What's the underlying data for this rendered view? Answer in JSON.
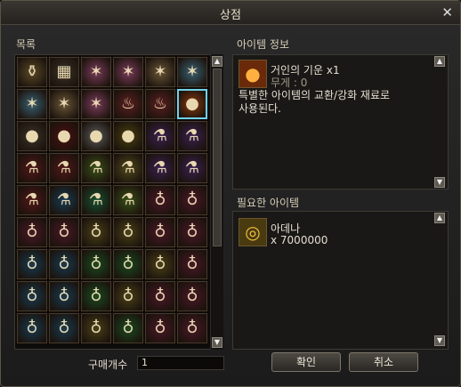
{
  "window": {
    "title": "상점",
    "close_glyph": "✕"
  },
  "list": {
    "label": "목록",
    "items": [
      {
        "icon": "jar-icon",
        "glyph": "⚱",
        "bg": "#5a4a28"
      },
      {
        "icon": "ladder-icon",
        "glyph": "▦",
        "bg": "#3c3428"
      },
      {
        "icon": "pink-scroll-icon",
        "glyph": "✶",
        "bg": "#7a3c5a"
      },
      {
        "icon": "pink-scroll-icon",
        "glyph": "✶",
        "bg": "#7a3c5a"
      },
      {
        "icon": "tan-scroll-icon",
        "glyph": "✶",
        "bg": "#6a5638"
      },
      {
        "icon": "blue-scroll-icon",
        "glyph": "✶",
        "bg": "#3a6070"
      },
      {
        "icon": "blue-scroll-icon",
        "glyph": "✶",
        "bg": "#3a6070"
      },
      {
        "icon": "tan-scroll-icon",
        "glyph": "✶",
        "bg": "#6a5638"
      },
      {
        "icon": "pink-scroll-icon",
        "glyph": "✶",
        "bg": "#7a3c5a"
      },
      {
        "icon": "red-flame-icon",
        "glyph": "♨",
        "bg": "#5a2020"
      },
      {
        "icon": "red-flame-icon",
        "glyph": "♨",
        "bg": "#5a2020"
      },
      {
        "icon": "fire-orb-icon",
        "glyph": "●",
        "bg": "#8a3a10"
      },
      {
        "icon": "dark-orb-icon",
        "glyph": "●",
        "bg": "#3a3428"
      },
      {
        "icon": "red-orb-icon",
        "glyph": "●",
        "bg": "#4a1010"
      },
      {
        "icon": "silver-orb-icon",
        "glyph": "●",
        "bg": "#5a5a5a"
      },
      {
        "icon": "gold-orb-icon",
        "glyph": "●",
        "bg": "#4a4010"
      },
      {
        "icon": "purple-vial-icon",
        "glyph": "⚗",
        "bg": "#3a2050"
      },
      {
        "icon": "purple-vial-icon",
        "glyph": "⚗",
        "bg": "#3a2050"
      },
      {
        "icon": "red-vial-icon",
        "glyph": "⚗",
        "bg": "#501818"
      },
      {
        "icon": "red-vial-icon",
        "glyph": "⚗",
        "bg": "#501818"
      },
      {
        "icon": "green-vial-icon",
        "glyph": "⚗",
        "bg": "#3a5018"
      },
      {
        "icon": "yellow-vial-icon",
        "glyph": "⚗",
        "bg": "#50481a"
      },
      {
        "icon": "purple-vial-icon",
        "glyph": "⚗",
        "bg": "#3a2050"
      },
      {
        "icon": "purple-vial-icon",
        "glyph": "⚗",
        "bg": "#3a2050"
      },
      {
        "icon": "red-vial-icon",
        "glyph": "⚗",
        "bg": "#501818"
      },
      {
        "icon": "blue-vial-icon",
        "glyph": "⚗",
        "bg": "#183a50"
      },
      {
        "icon": "green-vial-icon",
        "glyph": "⚗",
        "bg": "#185030"
      },
      {
        "icon": "green-vial-icon",
        "glyph": "⚗",
        "bg": "#3a5018"
      },
      {
        "icon": "potion-icon",
        "glyph": "♁",
        "bg": "#4a1828"
      },
      {
        "icon": "potion-icon",
        "glyph": "♁",
        "bg": "#4a1828"
      },
      {
        "icon": "potion-icon",
        "glyph": "♁",
        "bg": "#4a1828"
      },
      {
        "icon": "potion-icon",
        "glyph": "♁",
        "bg": "#4a1828"
      },
      {
        "icon": "potion-icon",
        "glyph": "♁",
        "bg": "#4a4018"
      },
      {
        "icon": "potion-icon",
        "glyph": "♁",
        "bg": "#4a4018"
      },
      {
        "icon": "potion-icon",
        "glyph": "♁",
        "bg": "#4a1828"
      },
      {
        "icon": "potion-icon",
        "glyph": "♁",
        "bg": "#4a1828"
      },
      {
        "icon": "potion-icon",
        "glyph": "♁",
        "bg": "#183a50"
      },
      {
        "icon": "potion-icon",
        "glyph": "♁",
        "bg": "#183a50"
      },
      {
        "icon": "potion-icon",
        "glyph": "♁",
        "bg": "#1a4a20"
      },
      {
        "icon": "potion-icon",
        "glyph": "♁",
        "bg": "#1a4a20"
      },
      {
        "icon": "potion-icon",
        "glyph": "♁",
        "bg": "#4a4018"
      },
      {
        "icon": "potion-icon",
        "glyph": "♁",
        "bg": "#4a1828"
      },
      {
        "icon": "potion-icon",
        "glyph": "♁",
        "bg": "#183a50"
      },
      {
        "icon": "potion-icon",
        "glyph": "♁",
        "bg": "#183a50"
      },
      {
        "icon": "potion-icon",
        "glyph": "♁",
        "bg": "#1a4a20"
      },
      {
        "icon": "potion-icon",
        "glyph": "♁",
        "bg": "#4a4018"
      },
      {
        "icon": "potion-icon",
        "glyph": "♁",
        "bg": "#4a1828"
      },
      {
        "icon": "potion-icon",
        "glyph": "♁",
        "bg": "#4a1828"
      },
      {
        "icon": "potion-icon",
        "glyph": "♁",
        "bg": "#183a50"
      },
      {
        "icon": "potion-icon",
        "glyph": "♁",
        "bg": "#183a50"
      },
      {
        "icon": "potion-icon",
        "glyph": "♁",
        "bg": "#4a4018"
      },
      {
        "icon": "potion-icon",
        "glyph": "♁",
        "bg": "#1a4a20"
      },
      {
        "icon": "potion-icon",
        "glyph": "♁",
        "bg": "#4a1828"
      },
      {
        "icon": "potion-icon",
        "glyph": "♁",
        "bg": "#4a1828"
      }
    ],
    "selected_index": 11
  },
  "item_info": {
    "label": "아이템 정보",
    "icon": "fire-orb-icon",
    "icon_glyph": "●",
    "name": "거인의 기운",
    "qty": "x1",
    "weight": "무게 : 0",
    "desc_line1": "특별한 아이템의 교환/강화 재료로",
    "desc_line2": "사용된다."
  },
  "required": {
    "label": "필요한 아이템",
    "icon": "adena-coins-icon",
    "icon_glyph": "◎",
    "name": "아데나",
    "qty": "x 7000000"
  },
  "purchase": {
    "qty_label": "구매개수",
    "qty_value": "1",
    "confirm_label": "확인",
    "cancel_label": "취소"
  },
  "colors": {
    "selected_border": "#6fd0e8",
    "panel_border": "#3d3a34"
  }
}
